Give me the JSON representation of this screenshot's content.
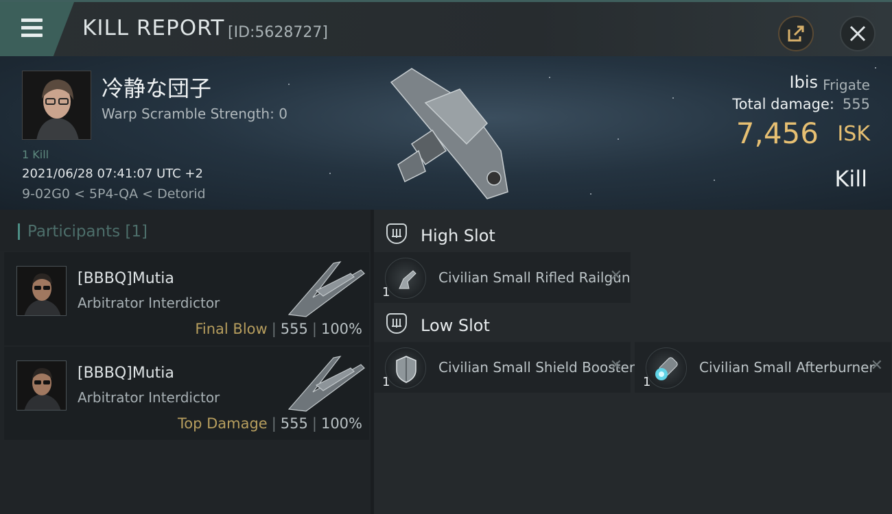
{
  "header": {
    "title": "KILL REPORT",
    "report_id": "[ID:5628727]"
  },
  "victim": {
    "name": "冷静な団子",
    "warp_scramble": "Warp Scramble Strength: 0",
    "kill_count": "1 Kill",
    "timestamp": "2021/06/28 07:41:07 UTC +2",
    "location": "9-02G0 < 5P4-QA < Detorid",
    "ship_name": "Ibis",
    "ship_class": "Frigate",
    "total_damage_label": "Total damage:",
    "total_damage": "555",
    "isk_value": "7,456",
    "isk_unit": "ISK",
    "kill_type": "Kill"
  },
  "participants": {
    "title": "Participants [1]",
    "rows": [
      {
        "name": "[BBBQ]Mutia",
        "ship": "Arbitrator Interdictor",
        "role": "Final Blow",
        "damage": "555",
        "percent": "100%"
      },
      {
        "name": "[BBBQ]Mutia",
        "ship": "Arbitrator Interdictor",
        "role": "Top Damage",
        "damage": "555",
        "percent": "100%"
      }
    ]
  },
  "slots": {
    "high": {
      "title": "High Slot",
      "items": [
        {
          "name": "Civilian Small Rifled Railgun",
          "qty": "1"
        }
      ]
    },
    "low": {
      "title": "Low Slot",
      "items": [
        {
          "name": "Civilian Small Shield Booster",
          "qty": "1"
        },
        {
          "name": "Civilian Small Afterburner",
          "qty": "1"
        }
      ]
    }
  },
  "icons": {
    "menu": "menu-icon",
    "share": "share-icon",
    "close": "close-icon",
    "slot": "shield-slot-icon",
    "remove": "close-x-icon"
  },
  "colors": {
    "accent": "#3c5f5a",
    "isk": "#e6bf72",
    "role": "#b79e5e"
  }
}
